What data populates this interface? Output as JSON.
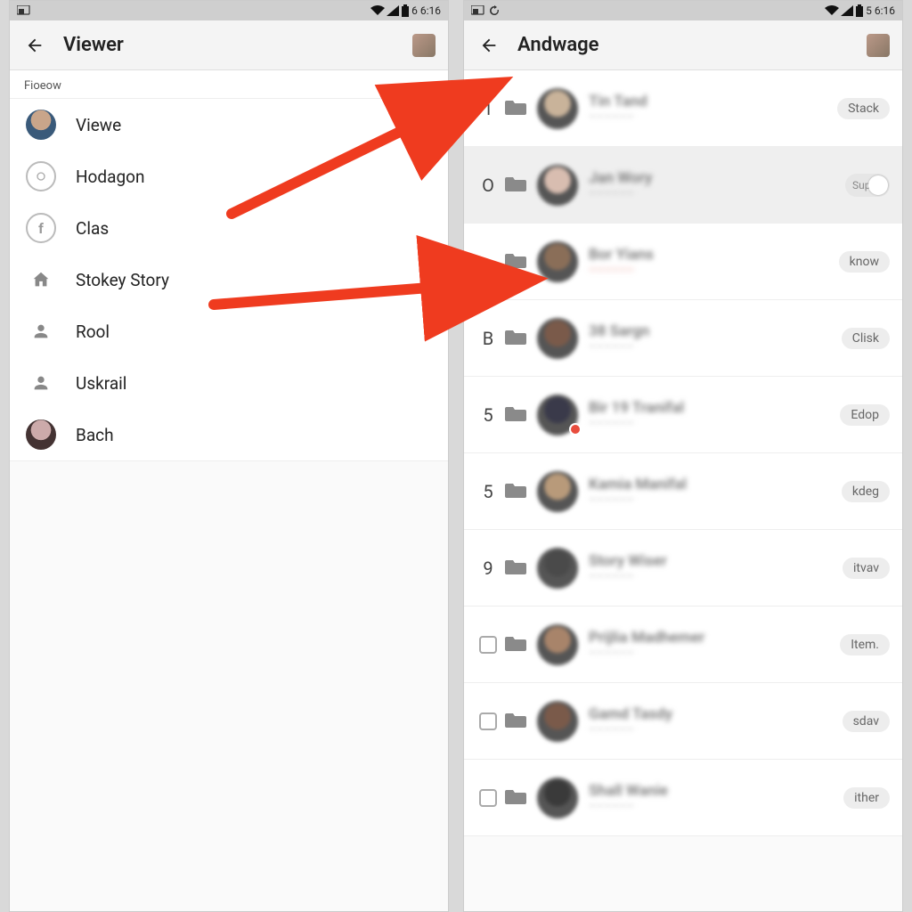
{
  "statusbar": {
    "time_left": "6 6:16",
    "time_right": "5 6:16"
  },
  "left": {
    "title": "Viewer",
    "section": "Fioeow",
    "items": [
      {
        "label": "Viewe",
        "iconClass": "photo1"
      },
      {
        "label": "Hodagon",
        "iconClass": "outline"
      },
      {
        "label": "Clas",
        "iconClass": "outline"
      },
      {
        "label": "Stokey Story",
        "iconClass": ""
      },
      {
        "label": "Rool",
        "iconClass": ""
      },
      {
        "label": "Uskrail",
        "iconClass": ""
      },
      {
        "label": "Bach",
        "iconClass": "photo2"
      }
    ]
  },
  "right": {
    "title": "Andwage",
    "rows": [
      {
        "num": "1",
        "name": "Tin Tand",
        "sub": "",
        "action": "Stack",
        "type": "pill",
        "avatar": "#c9b39a"
      },
      {
        "num": "O",
        "name": "Jan Wory",
        "sub": "",
        "action": "Sup",
        "type": "toggle",
        "avatar": "#d8bdb0",
        "selected": true
      },
      {
        "num": "",
        "name": "Bor Yians",
        "sub": "red",
        "action": "know",
        "type": "pill",
        "avatar": "#8a6e58"
      },
      {
        "num": "B",
        "name": "38 Sargn",
        "sub": "",
        "action": "Clisk",
        "type": "pill",
        "avatar": "#7a5a4a"
      },
      {
        "num": "5",
        "name": "Bir 19 Tranifal",
        "sub": "",
        "action": "Edop",
        "type": "pill",
        "avatar": "#3a3a4a",
        "badge": true
      },
      {
        "num": "5",
        "name": "Kamia Manifal",
        "sub": "",
        "action": "kdeg",
        "type": "pill",
        "avatar": "#b89a7a"
      },
      {
        "num": "9",
        "name": "Story Wiser",
        "sub": "",
        "action": "itvav",
        "type": "pill",
        "avatar": "#4a4a4a"
      },
      {
        "num": "box",
        "name": "Prijlia Madhemer",
        "sub": "",
        "action": "Item.",
        "type": "pill",
        "avatar": "#a8846a"
      },
      {
        "num": "box",
        "name": "Gamd Tasdy",
        "sub": "",
        "action": "sdav",
        "type": "pill",
        "avatar": "#7a5a4a"
      },
      {
        "num": "box",
        "name": "Shall Wanie",
        "sub": "",
        "action": "ither",
        "type": "pill",
        "avatar": "#3a3a3a"
      }
    ]
  }
}
